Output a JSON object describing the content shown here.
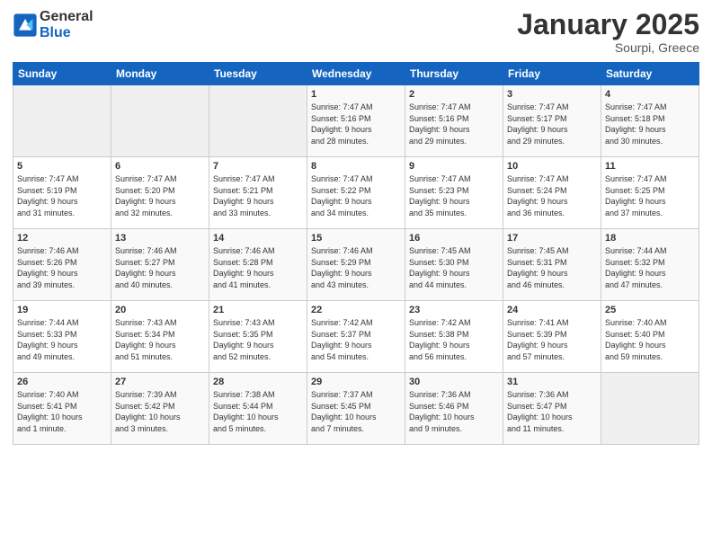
{
  "logo": {
    "general": "General",
    "blue": "Blue"
  },
  "header": {
    "month": "January 2025",
    "location": "Sourpi, Greece"
  },
  "weekdays": [
    "Sunday",
    "Monday",
    "Tuesday",
    "Wednesday",
    "Thursday",
    "Friday",
    "Saturday"
  ],
  "weeks": [
    [
      {
        "day": "",
        "info": ""
      },
      {
        "day": "",
        "info": ""
      },
      {
        "day": "",
        "info": ""
      },
      {
        "day": "1",
        "info": "Sunrise: 7:47 AM\nSunset: 5:16 PM\nDaylight: 9 hours\nand 28 minutes."
      },
      {
        "day": "2",
        "info": "Sunrise: 7:47 AM\nSunset: 5:16 PM\nDaylight: 9 hours\nand 29 minutes."
      },
      {
        "day": "3",
        "info": "Sunrise: 7:47 AM\nSunset: 5:17 PM\nDaylight: 9 hours\nand 29 minutes."
      },
      {
        "day": "4",
        "info": "Sunrise: 7:47 AM\nSunset: 5:18 PM\nDaylight: 9 hours\nand 30 minutes."
      }
    ],
    [
      {
        "day": "5",
        "info": "Sunrise: 7:47 AM\nSunset: 5:19 PM\nDaylight: 9 hours\nand 31 minutes."
      },
      {
        "day": "6",
        "info": "Sunrise: 7:47 AM\nSunset: 5:20 PM\nDaylight: 9 hours\nand 32 minutes."
      },
      {
        "day": "7",
        "info": "Sunrise: 7:47 AM\nSunset: 5:21 PM\nDaylight: 9 hours\nand 33 minutes."
      },
      {
        "day": "8",
        "info": "Sunrise: 7:47 AM\nSunset: 5:22 PM\nDaylight: 9 hours\nand 34 minutes."
      },
      {
        "day": "9",
        "info": "Sunrise: 7:47 AM\nSunset: 5:23 PM\nDaylight: 9 hours\nand 35 minutes."
      },
      {
        "day": "10",
        "info": "Sunrise: 7:47 AM\nSunset: 5:24 PM\nDaylight: 9 hours\nand 36 minutes."
      },
      {
        "day": "11",
        "info": "Sunrise: 7:47 AM\nSunset: 5:25 PM\nDaylight: 9 hours\nand 37 minutes."
      }
    ],
    [
      {
        "day": "12",
        "info": "Sunrise: 7:46 AM\nSunset: 5:26 PM\nDaylight: 9 hours\nand 39 minutes."
      },
      {
        "day": "13",
        "info": "Sunrise: 7:46 AM\nSunset: 5:27 PM\nDaylight: 9 hours\nand 40 minutes."
      },
      {
        "day": "14",
        "info": "Sunrise: 7:46 AM\nSunset: 5:28 PM\nDaylight: 9 hours\nand 41 minutes."
      },
      {
        "day": "15",
        "info": "Sunrise: 7:46 AM\nSunset: 5:29 PM\nDaylight: 9 hours\nand 43 minutes."
      },
      {
        "day": "16",
        "info": "Sunrise: 7:45 AM\nSunset: 5:30 PM\nDaylight: 9 hours\nand 44 minutes."
      },
      {
        "day": "17",
        "info": "Sunrise: 7:45 AM\nSunset: 5:31 PM\nDaylight: 9 hours\nand 46 minutes."
      },
      {
        "day": "18",
        "info": "Sunrise: 7:44 AM\nSunset: 5:32 PM\nDaylight: 9 hours\nand 47 minutes."
      }
    ],
    [
      {
        "day": "19",
        "info": "Sunrise: 7:44 AM\nSunset: 5:33 PM\nDaylight: 9 hours\nand 49 minutes."
      },
      {
        "day": "20",
        "info": "Sunrise: 7:43 AM\nSunset: 5:34 PM\nDaylight: 9 hours\nand 51 minutes."
      },
      {
        "day": "21",
        "info": "Sunrise: 7:43 AM\nSunset: 5:35 PM\nDaylight: 9 hours\nand 52 minutes."
      },
      {
        "day": "22",
        "info": "Sunrise: 7:42 AM\nSunset: 5:37 PM\nDaylight: 9 hours\nand 54 minutes."
      },
      {
        "day": "23",
        "info": "Sunrise: 7:42 AM\nSunset: 5:38 PM\nDaylight: 9 hours\nand 56 minutes."
      },
      {
        "day": "24",
        "info": "Sunrise: 7:41 AM\nSunset: 5:39 PM\nDaylight: 9 hours\nand 57 minutes."
      },
      {
        "day": "25",
        "info": "Sunrise: 7:40 AM\nSunset: 5:40 PM\nDaylight: 9 hours\nand 59 minutes."
      }
    ],
    [
      {
        "day": "26",
        "info": "Sunrise: 7:40 AM\nSunset: 5:41 PM\nDaylight: 10 hours\nand 1 minute."
      },
      {
        "day": "27",
        "info": "Sunrise: 7:39 AM\nSunset: 5:42 PM\nDaylight: 10 hours\nand 3 minutes."
      },
      {
        "day": "28",
        "info": "Sunrise: 7:38 AM\nSunset: 5:44 PM\nDaylight: 10 hours\nand 5 minutes."
      },
      {
        "day": "29",
        "info": "Sunrise: 7:37 AM\nSunset: 5:45 PM\nDaylight: 10 hours\nand 7 minutes."
      },
      {
        "day": "30",
        "info": "Sunrise: 7:36 AM\nSunset: 5:46 PM\nDaylight: 10 hours\nand 9 minutes."
      },
      {
        "day": "31",
        "info": "Sunrise: 7:36 AM\nSunset: 5:47 PM\nDaylight: 10 hours\nand 11 minutes."
      },
      {
        "day": "",
        "info": ""
      }
    ]
  ]
}
